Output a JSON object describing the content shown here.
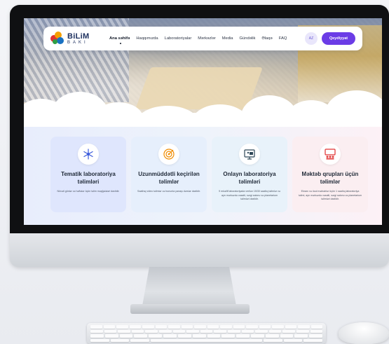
{
  "site": {
    "logo_title": "BiLiM",
    "logo_sub": "BAKI",
    "nav": [
      {
        "label": "Ana səhifə",
        "active": true
      },
      {
        "label": "Haqqımızda",
        "active": false
      },
      {
        "label": "Laboratoriyalar",
        "active": false
      },
      {
        "label": "Mərkəzlər",
        "active": false
      },
      {
        "label": "Media",
        "active": false
      },
      {
        "label": "Gündəlik",
        "active": false
      },
      {
        "label": "Əlaqə",
        "active": false
      },
      {
        "label": "FAQ",
        "active": false
      }
    ],
    "lang": "AZ",
    "register_label": "Qeydiyyat"
  },
  "cards": [
    {
      "title": "Tematik laboratoriya təlimləri",
      "desc": "Növəti günlər və həftələr üçün təlim məşğələləri daxildir.",
      "icon": "snowflake-icon",
      "bg": "#dfe6fd",
      "accent": "#3b5bdb"
    },
    {
      "title": "Uzunmüddətli keçirilən təlimlər",
      "desc": "Saathıq video təlimlər və bununla yanaşı dərslər daxildir.",
      "icon": "target-icon",
      "bg": "#e6effc",
      "accent": "#f08c00"
    },
    {
      "title": "Onlayn laboratoriya təlimləri",
      "desc": "9 müəllif laboratoriyada verilən 15/30 saatlıq təlimlər və ayrı mərkəzdə vəsaiti, sərgi salonu və planetarium təlimləri daxildir.",
      "icon": "monitor-icon",
      "bg": "#e8f2fa",
      "accent": "#2f4858"
    },
    {
      "title": "Məktəb qrupları üçün təlimlər",
      "desc": "Ekranı və özəl məktəblər üçün 1 saatlıq laboratoriya təlimi, ayrı mərkəzdə vəsaiti, sərgi salonu və planetarium təlimləri daxildir.",
      "icon": "classroom-icon",
      "bg": "#fbeef1",
      "accent": "#e03131"
    }
  ],
  "colors": {
    "brand_purple": "#6b3ce6",
    "navy": "#1c2f5e"
  }
}
